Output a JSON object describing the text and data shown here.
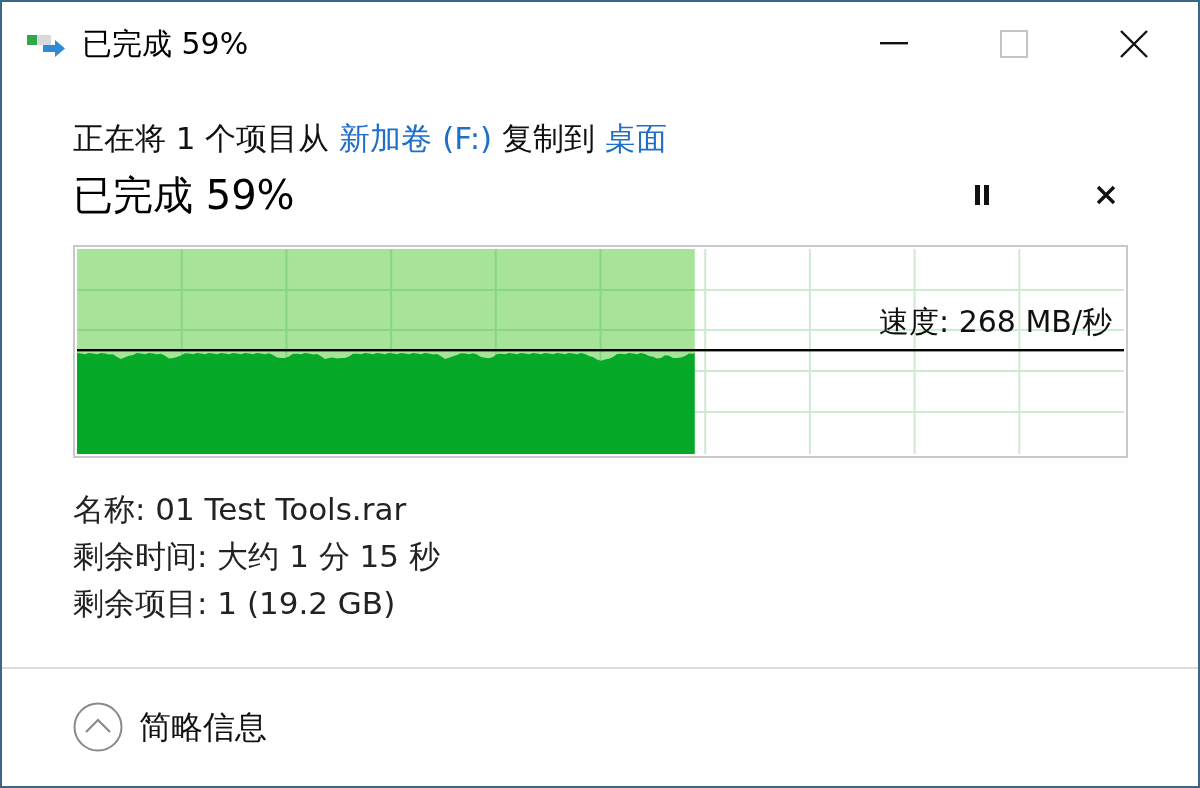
{
  "window": {
    "title": "已完成 59%",
    "controls": [
      {
        "kind": "minimize",
        "disabled": false
      },
      {
        "kind": "maximize",
        "disabled": true
      },
      {
        "kind": "close",
        "disabled": false
      }
    ]
  },
  "description": [
    {
      "kind": "text",
      "text": "正在将 1 个项目从 "
    },
    {
      "kind": "link",
      "text": "新加卷 (F:)"
    },
    {
      "kind": "text",
      "text": " 复制到 "
    },
    {
      "kind": "link",
      "text": "桌面"
    }
  ],
  "progress": {
    "heading": "已完成 59%",
    "actions": [
      {
        "kind": "pause"
      },
      {
        "kind": "cancel"
      }
    ]
  },
  "graph": {
    "level": 0.59,
    "speed_label": "速度: 268 MB/秒"
  },
  "details": [
    "名称: 01 Test Tools.rar",
    "剩余时间: 大约 1 分 15 秒",
    "剩余项目: 1 (19.2 GB)"
  ],
  "footer": {
    "toggle_label": "简略信息",
    "expanded": true
  }
}
